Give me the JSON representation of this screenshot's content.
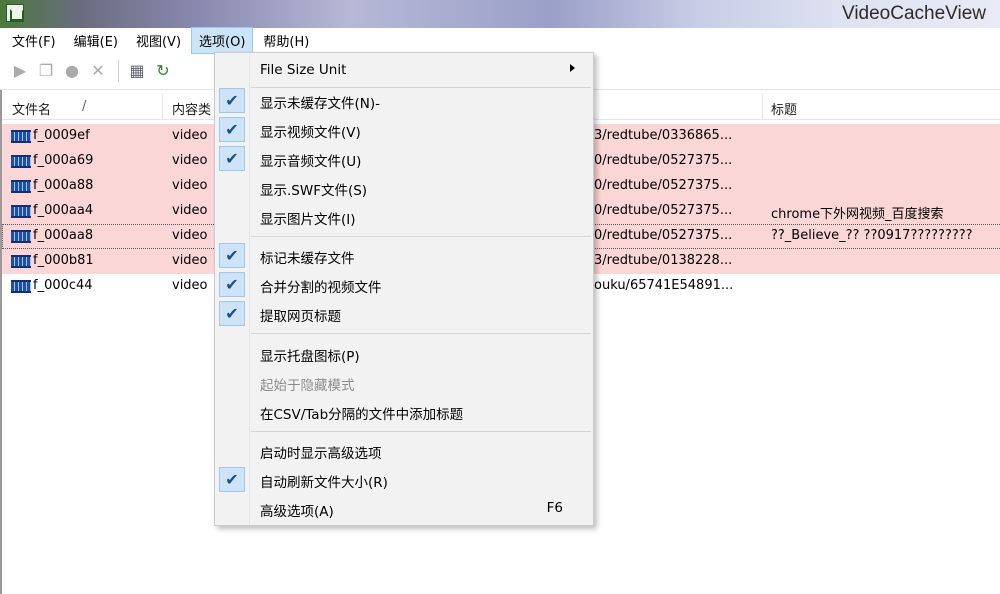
{
  "window": {
    "title": "VideoCacheView"
  },
  "menubar": [
    {
      "label": "文件(F)"
    },
    {
      "label": "编辑(E)"
    },
    {
      "label": "视图(V)"
    },
    {
      "label": "选项(O)"
    },
    {
      "label": "帮助(H)"
    }
  ],
  "toolbar": {
    "icons": [
      "play-icon",
      "copy-icon",
      "record-icon",
      "close-icon",
      "save-icon",
      "refresh-icon"
    ]
  },
  "list": {
    "columns": [
      "文件名",
      "内容类",
      "标题"
    ],
    "sort_indicator": "/",
    "rows": [
      {
        "name": "f_0009ef",
        "type": "video",
        "url": "3/redtube/0336865...",
        "title": ""
      },
      {
        "name": "f_000a69",
        "type": "video",
        "url": "0/redtube/0527375...",
        "title": ""
      },
      {
        "name": "f_000a88",
        "type": "video",
        "url": "0/redtube/0527375...",
        "title": ""
      },
      {
        "name": "f_000aa4",
        "type": "video",
        "url": "0/redtube/0527375...",
        "title": "chrome下外网视频_百度搜索"
      },
      {
        "name": "f_000aa8",
        "type": "video",
        "url": "0/redtube/0527375...",
        "title": "??_Believe_?? ??0917?????????"
      },
      {
        "name": "f_000b81",
        "type": "video",
        "url": "3/redtube/0138228...",
        "title": ""
      },
      {
        "name": "f_000c44",
        "type": "video",
        "url": "ouku/65741E54891...",
        "title": ""
      }
    ]
  },
  "options_menu": {
    "items": [
      {
        "label": "File Size Unit",
        "checked": false,
        "submenu": true
      },
      {
        "label": "显示未缓存文件(N)-",
        "checked": true
      },
      {
        "label": "显示视频文件(V)",
        "checked": true
      },
      {
        "label": "显示音频文件(U)",
        "checked": true
      },
      {
        "label": "显示.SWF文件(S)",
        "checked": false
      },
      {
        "label": "显示图片文件(I)",
        "checked": false
      },
      {
        "label": "标记未缓存文件",
        "checked": true
      },
      {
        "label": "合并分割的视频文件",
        "checked": true
      },
      {
        "label": "提取网页标题",
        "checked": true
      },
      {
        "label": "显示托盘图标(P)",
        "checked": false
      },
      {
        "label": "起始于隐藏模式",
        "checked": false,
        "disabled": true
      },
      {
        "label": "在CSV/Tab分隔的文件中添加标题",
        "checked": false
      },
      {
        "label": "启动时显示高级选项",
        "checked": false
      },
      {
        "label": "自动刷新文件大小(R)",
        "checked": true
      },
      {
        "label": "高级选项(A)",
        "checked": false,
        "shortcut": "F6"
      }
    ]
  },
  "colors": {
    "uncached_row": "#fbd6d6",
    "menu_highlight": "#cce4f7",
    "check_bg": "#cfe3f7"
  }
}
